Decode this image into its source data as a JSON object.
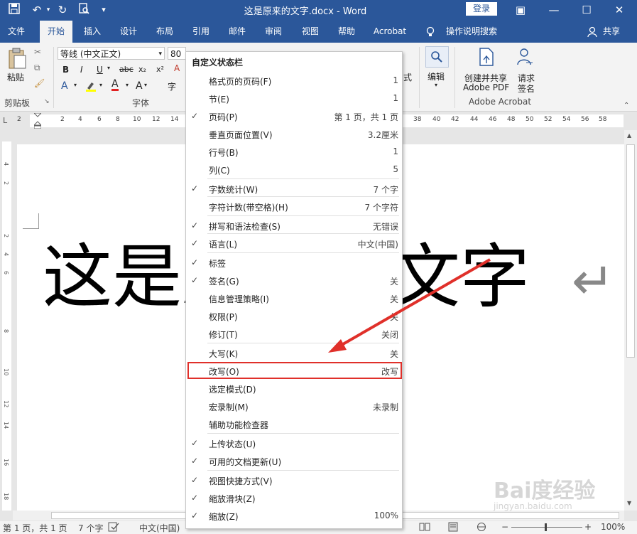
{
  "window": {
    "doc_title": "这是原来的文字.docx  -  Word",
    "login_label": "登录",
    "minimize_glyph": "—",
    "maximize_glyph": "☐",
    "close_glyph": "✕",
    "restore_ribbon_glyph": "▣"
  },
  "tabs": [
    "文件",
    "开始",
    "插入",
    "设计",
    "布局",
    "引用",
    "邮件",
    "审阅",
    "视图",
    "帮助",
    "Acrobat",
    "操作说明搜索",
    "共享"
  ],
  "ribbon": {
    "paste_label": "粘贴",
    "clipboard_group": "剪贴板",
    "font_name": "等线 (中文正文)",
    "font_size": "80",
    "font_group": "字体",
    "bold": "B",
    "italic": "I",
    "underline": "U",
    "strike": "abc",
    "subscript": "x₂",
    "superscript": "x²",
    "edit_label": "编辑",
    "create_share_label": "创建并共享\nAdobe PDF",
    "create_share_l1": "创建并共享",
    "create_share_l2": "Adobe PDF",
    "request_sign_l1": "请求",
    "request_sign_l2": "签名",
    "acrobat_group": "Adobe Acrobat",
    "styles_partial": "式"
  },
  "ruler": {
    "numbers": [
      "2",
      "2",
      "4",
      "6",
      "8",
      "10",
      "12",
      "14",
      "38",
      "40",
      "42",
      "44",
      "46",
      "48",
      "50",
      "52",
      "54",
      "56",
      "58"
    ]
  },
  "vruler": {
    "numbers": [
      "4",
      "2",
      "2",
      "4",
      "6",
      "8",
      "10",
      "12",
      "14",
      "16",
      "18"
    ]
  },
  "document": {
    "text": "这是原来的文字",
    "para_mark": "↵"
  },
  "status": {
    "page": "第 1 页，共 1 页",
    "words": "7 个字",
    "lang": "中文(中国)",
    "zoom": "100%"
  },
  "menu": {
    "title": "自定义状态栏",
    "items": [
      {
        "label": "格式页的页码(F)",
        "value": "1",
        "checked": false
      },
      {
        "label": "节(E)",
        "value": "1",
        "checked": false
      },
      {
        "label": "页码(P)",
        "value": "第 1 页，共 1 页",
        "checked": true
      },
      {
        "label": "垂直页面位置(V)",
        "value": "3.2厘米",
        "checked": false
      },
      {
        "label": "行号(B)",
        "value": "1",
        "checked": false
      },
      {
        "label": "列(C)",
        "value": "5",
        "checked": false
      },
      {
        "label": "字数统计(W)",
        "value": "7 个字",
        "checked": true
      },
      {
        "label": "字符计数(带空格)(H)",
        "value": "7 个字符",
        "checked": false
      },
      {
        "label": "拼写和语法检查(S)",
        "value": "无错误",
        "checked": true
      },
      {
        "label": "语言(L)",
        "value": "中文(中国)",
        "checked": true
      },
      {
        "label": "标签",
        "value": "",
        "checked": true
      },
      {
        "label": "签名(G)",
        "value": "关",
        "checked": true
      },
      {
        "label": "信息管理策略(I)",
        "value": "关",
        "checked": false
      },
      {
        "label": "权限(P)",
        "value": "关",
        "checked": false
      },
      {
        "label": "修订(T)",
        "value": "关闭",
        "checked": false
      },
      {
        "label": "大写(K)",
        "value": "关",
        "checked": false
      },
      {
        "label": "改写(O)",
        "value": "改写",
        "checked": false
      },
      {
        "label": "选定模式(D)",
        "value": "",
        "checked": false
      },
      {
        "label": "宏录制(M)",
        "value": "未录制",
        "checked": false
      },
      {
        "label": "辅助功能检查器",
        "value": "",
        "checked": false
      },
      {
        "label": "上传状态(U)",
        "value": "",
        "checked": true
      },
      {
        "label": "可用的文档更新(U)",
        "value": "",
        "checked": true
      },
      {
        "label": "视图快捷方式(V)",
        "value": "",
        "checked": true
      },
      {
        "label": "缩放滑块(Z)",
        "value": "",
        "checked": true
      },
      {
        "label": "缩放(Z)",
        "value": "100%",
        "checked": true
      }
    ]
  },
  "watermark": {
    "main": "Bai度经验",
    "sub": "jingyan.baidu.com"
  },
  "colors": {
    "brand": "#2b579a",
    "highlight": "#e0302a"
  }
}
